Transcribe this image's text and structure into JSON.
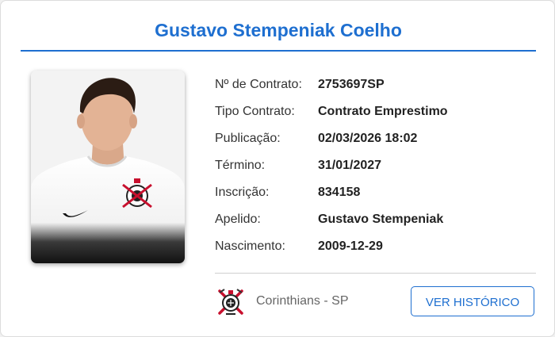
{
  "player": {
    "name": "Gustavo Stempeniak Coelho"
  },
  "details": [
    {
      "label": "Nº de Contrato:",
      "value": "2753697SP"
    },
    {
      "label": "Tipo Contrato:",
      "value": "Contrato Emprestimo"
    },
    {
      "label": "Publicação:",
      "value": "02/03/2026 18:02"
    },
    {
      "label": "Término:",
      "value": "31/01/2027"
    },
    {
      "label": "Inscrição:",
      "value": "834158"
    },
    {
      "label": "Apelido:",
      "value": "Gustavo Stempeniak"
    },
    {
      "label": "Nascimento:",
      "value": "2009-12-29"
    }
  ],
  "club": {
    "name": "Corinthians - SP",
    "logo_icon": "corinthians-crest-icon"
  },
  "actions": {
    "history_label": "VER HISTÓRICO"
  },
  "colors": {
    "accent": "#1e6fd0",
    "text": "#222222",
    "muted": "#666666",
    "club_red": "#c8102e"
  }
}
